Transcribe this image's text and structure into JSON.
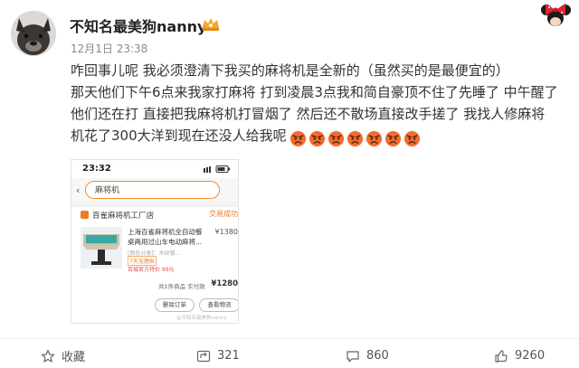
{
  "post": {
    "username": "不知名最美狗nanny",
    "timestamp": "12月1日 23:38",
    "lines": [
      "咋回事儿呢 我必须澄清下我买的麻将机是全新的（虽然买的是最便宜的）",
      "那天他们下午6点来我家打麻将 打到凌晨3点我和简自豪顶不住了先睡了 中午醒了",
      "他们还在打 直接把我麻将机打冒烟了 然后还不散场直接改手搓了 我找人修麻将",
      "机花了300大洋到现在还没人给我呢"
    ],
    "emoji_count": 7
  },
  "screenshot": {
    "time": "23:32",
    "search_text": "麻将机",
    "shop_name": "百雀麻将机工厂店",
    "order_status": "交易成功",
    "product_title_1": "上海百雀麻将机全自动餐",
    "product_title_2": "桌两用过山车电动麻将...",
    "spec": "[颜色分类]：木纹餐...",
    "price": "¥1380",
    "tag": "7天无理由",
    "sale_note": "百城官方特价 99元",
    "total_label": "共1件商品 实付款",
    "total": "¥1280",
    "button_1": "删除订单",
    "button_2": "查看物流",
    "watermark": "@不知名最美狗nanny"
  },
  "actions": {
    "favorite": "收藏",
    "repost": "321",
    "comment": "860",
    "like": "9260"
  },
  "colors": {
    "accent": "#f07a23",
    "emoji_face": "#f26b2f",
    "vip_gold": "#f5a623"
  }
}
